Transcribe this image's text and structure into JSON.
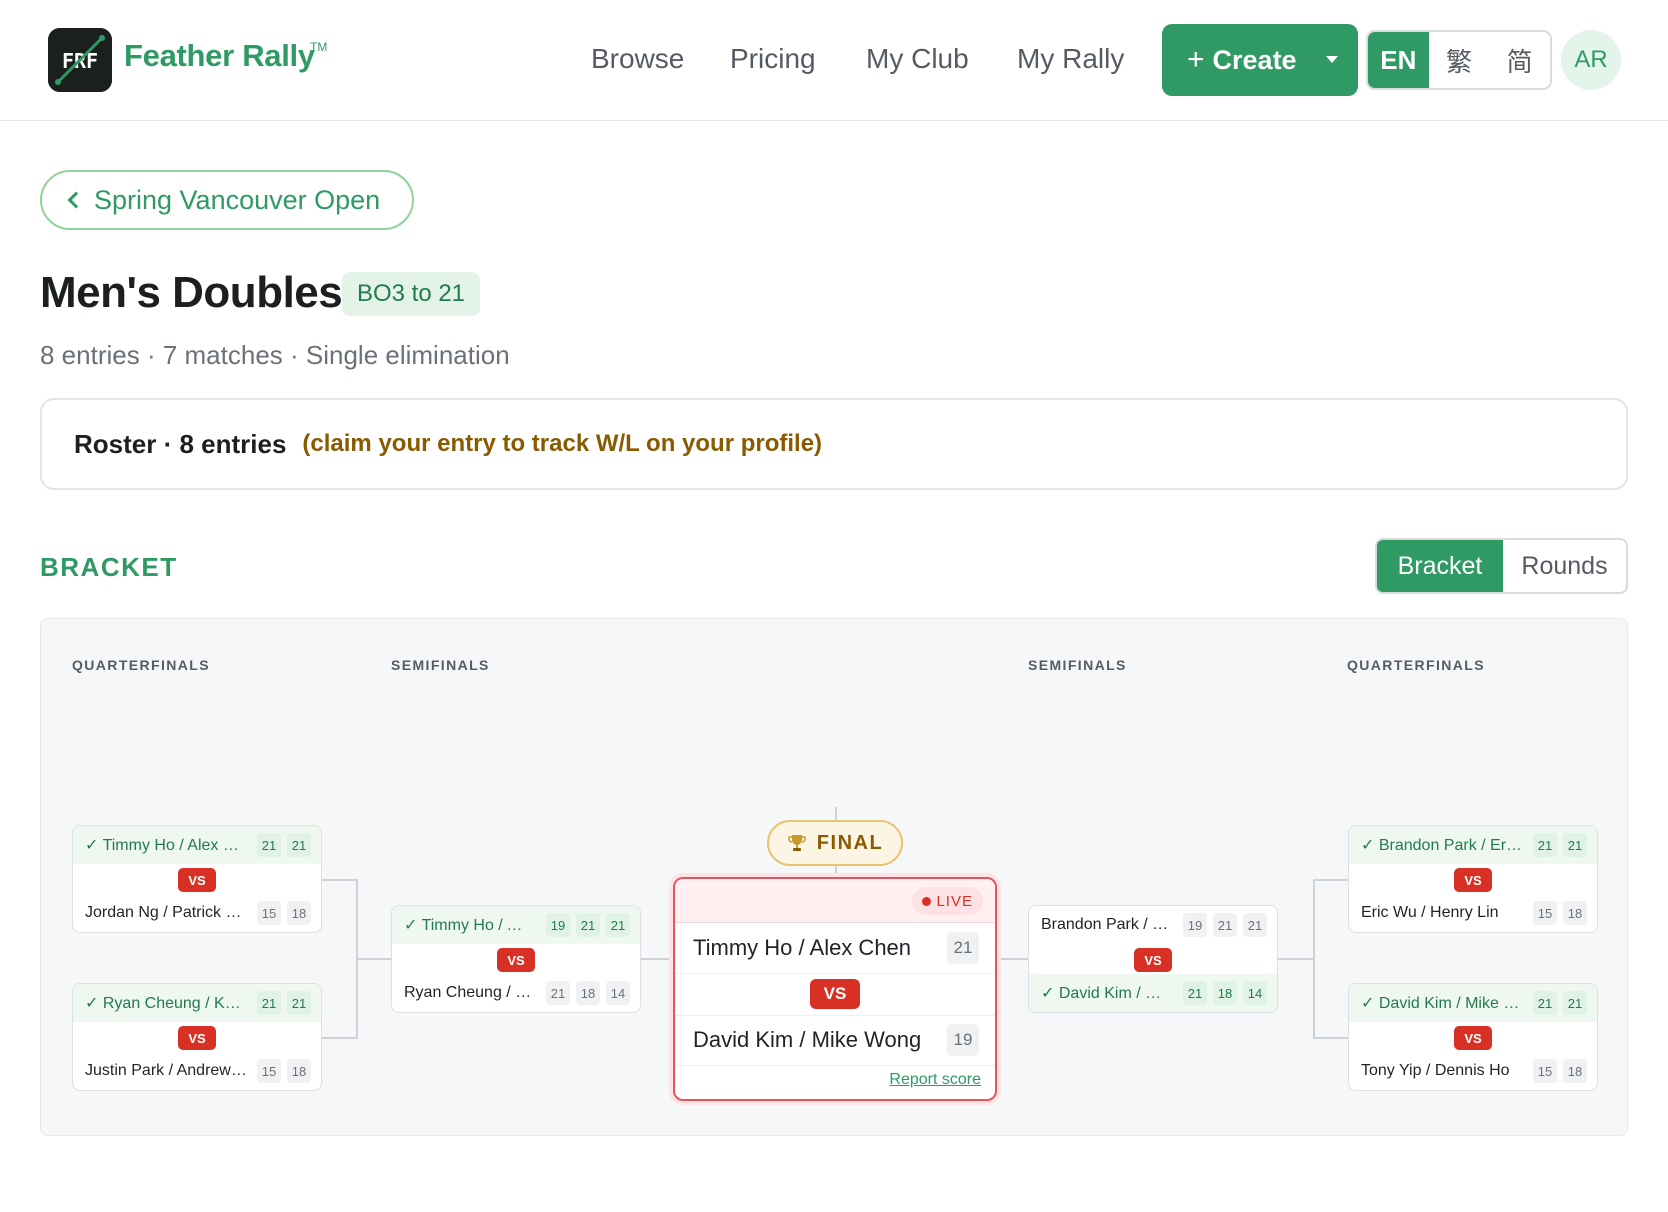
{
  "header": {
    "brand": "Feather Rally",
    "trademark": "TM",
    "logo_text": "FRF",
    "nav": [
      "Browse",
      "Pricing",
      "My Club",
      "My Rally"
    ],
    "create_label": "Create",
    "languages": [
      "EN",
      "繁",
      "简"
    ],
    "active_language": "EN",
    "avatar_initials": "AR"
  },
  "page": {
    "back_label": "Spring Vancouver Open",
    "title": "Men's Doubles",
    "format_badge": "BO3 to 21",
    "subtitle": "8 entries · 7 matches · Single elimination",
    "roster_title": "Roster · 8 entries",
    "roster_hint": "(claim your entry to track W/L on your profile)"
  },
  "bracket": {
    "section_label": "BRACKET",
    "view_options": [
      "Bracket",
      "Rounds"
    ],
    "active_view": "Bracket",
    "round_labels": {
      "left_qf": "QUARTERFINALS",
      "left_sf": "SEMIFINALS",
      "right_sf": "SEMIFINALS",
      "right_qf": "QUARTERFINALS"
    },
    "vs_label": "VS",
    "final_label": "FINAL",
    "live_label": "LIVE",
    "report_label": "Report score",
    "left_qf": [
      {
        "top": {
          "name": "Timmy Ho / Alex Chen",
          "winner": true,
          "scores": [
            "21",
            "21"
          ]
        },
        "bottom": {
          "name": "Jordan Ng / Patrick Lee",
          "winner": false,
          "scores": [
            "15",
            "18"
          ]
        }
      },
      {
        "top": {
          "name": "Ryan Cheung / Kevin Lau",
          "winner": true,
          "scores": [
            "21",
            "21"
          ]
        },
        "bottom": {
          "name": "Justin Park / Andrew Tam",
          "winner": false,
          "scores": [
            "15",
            "18"
          ]
        }
      }
    ],
    "left_sf": {
      "top": {
        "name": "Timmy Ho / Alex Chen",
        "winner": true,
        "scores": [
          "19",
          "21",
          "21"
        ]
      },
      "bottom": {
        "name": "Ryan Cheung / Kevin Lau",
        "winner": false,
        "scores": [
          "21",
          "18",
          "14"
        ]
      }
    },
    "final": {
      "team1": {
        "name": "Timmy Ho / Alex Chen",
        "score": "21"
      },
      "team2": {
        "name": "David Kim / Mike Wong",
        "score": "19"
      }
    },
    "right_sf": {
      "top": {
        "name": "Brandon Park / Eric Wu",
        "winner": false,
        "scores": [
          "19",
          "21",
          "21"
        ]
      },
      "bottom": {
        "name": "David Kim / Mike Wong",
        "winner": true,
        "scores": [
          "21",
          "18",
          "14"
        ]
      }
    },
    "right_qf": [
      {
        "top": {
          "name": "Brandon Park / Eric Chan",
          "winner": true,
          "scores": [
            "21",
            "21"
          ]
        },
        "bottom": {
          "name": "Eric Wu / Henry Lin",
          "winner": false,
          "scores": [
            "15",
            "18"
          ]
        }
      },
      {
        "top": {
          "name": "David Kim / Mike Wong",
          "winner": true,
          "scores": [
            "21",
            "21"
          ]
        },
        "bottom": {
          "name": "Tony Yip / Dennis Ho",
          "winner": false,
          "scores": [
            "15",
            "18"
          ]
        }
      }
    ]
  },
  "colors": {
    "brand_green": "#2f9a63",
    "live_red": "#d93025",
    "hint_brown": "#8a5a00"
  }
}
